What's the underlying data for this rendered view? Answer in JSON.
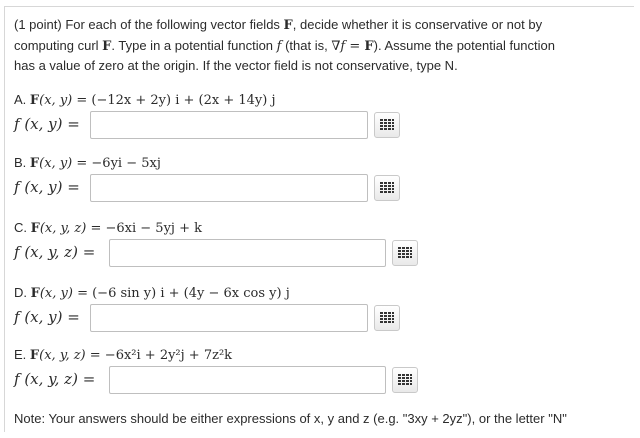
{
  "intro": {
    "points": "(1 point)",
    "line1_rest": " For each of the following vector fields ",
    "F": "F",
    "line1_end": ", decide whether it is conservative or not by",
    "line2": "computing curl ",
    "line2b": ". Type in a potential function ",
    "f": "f",
    "line2c": " (that is, ",
    "grad": "∇f = ",
    "Fclose": "F",
    "line2d": "). Assume the potential function",
    "line3": "has a value of zero at the origin. If the vector field is not conservative, type N."
  },
  "parts": [
    {
      "letter": "A.",
      "F_lhs": "F",
      "args": "(x, y) = ",
      "expr": "(−12x + 2y) i + (2x + 14y) j",
      "f_label": "f (x, y) =",
      "answer": ""
    },
    {
      "letter": "B.",
      "F_lhs": "F",
      "args": "(x, y) = ",
      "expr": "−6yi − 5xj",
      "f_label": "f (x, y) =",
      "answer": ""
    },
    {
      "letter": "C.",
      "F_lhs": "F",
      "args": "(x, y, z) = ",
      "expr": "−6xi − 5yj + k",
      "f_label": "f (x, y, z) =",
      "answer": ""
    },
    {
      "letter": "D.",
      "F_lhs": "F",
      "args": "(x, y) = ",
      "expr": "(−6 sin y) i + (4y − 6x cos y) j",
      "f_label": "f (x, y) =",
      "answer": ""
    },
    {
      "letter": "E.",
      "F_lhs": "F",
      "args": "(x, y, z) = ",
      "expr": "−6x²i + 2y²j + 7z²k",
      "f_label": "f (x, y, z) =",
      "answer": ""
    }
  ],
  "note": "Note: Your answers should be either expressions of x, y and z (e.g. \"3xy + 2yz\"), or the letter \"N\"",
  "icons": {
    "equation_editor": "grid-icon"
  },
  "colors": {
    "border": "#bfbfbf",
    "text": "#2b2b2b",
    "icon": "#333333"
  }
}
